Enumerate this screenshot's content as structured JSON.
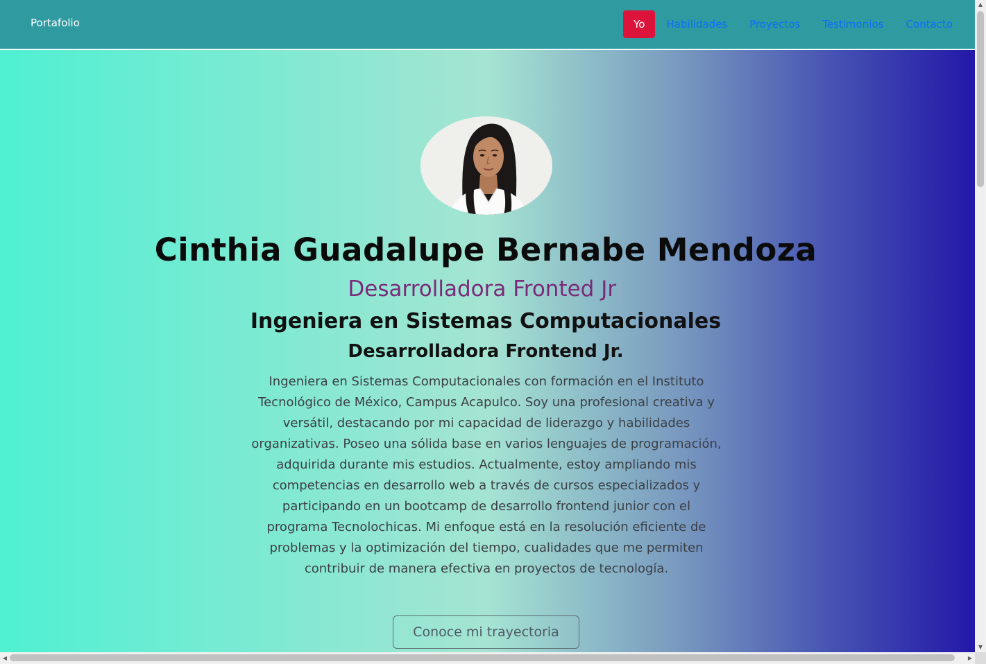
{
  "navbar": {
    "brand": "Portafolio",
    "items": [
      {
        "label": "Yo",
        "active": true
      },
      {
        "label": "Habilidades",
        "active": false
      },
      {
        "label": "Proyectos",
        "active": false
      },
      {
        "label": "Testimonios",
        "active": false
      },
      {
        "label": "Contacto",
        "active": false
      }
    ]
  },
  "hero": {
    "avatar_alt": "profile-photo",
    "name": "Cinthia Guadalupe Bernabe Mendoza",
    "typed_text": "Desarrolladora Fronted Jr",
    "typed_cursor": "|",
    "subtitle1": "Ingeniera en Sistemas Computacionales",
    "subtitle2": "Desarrolladora Frontend Jr.",
    "bio": "Ingeniera en Sistemas Computacionales con formación en el Instituto Tecnológico de México, Campus Acapulco. Soy una profesional creativa y versátil, destacando por mi capacidad de liderazgo y habilidades organizativas. Poseo una sólida base en varios lenguajes de programación, adquirida durante mis estudios. Actualmente, estoy ampliando mis competencias en desarrollo web a través de cursos especializados y participando en un bootcamp de desarrollo frontend junior con el programa Tecnolochicas. Mi enfoque está en la resolución eficiente de problemas y la optimización del tiempo, cualidades que me permiten contribuir de manera efectiva en proyectos de tecnología.",
    "cta_label": "Conoce mi trayectoria"
  },
  "colors": {
    "navbar_bg": "#2f9aa0",
    "active_nav_bg": "#dc143c",
    "nav_link": "#0d6efd",
    "typed_text": "#7a2a7a",
    "gradient_start": "#4ff0d3",
    "gradient_end": "#2318a8"
  }
}
